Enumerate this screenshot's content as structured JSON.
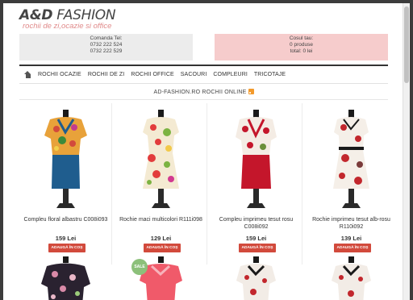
{
  "logo": {
    "brand_bold": "A&D",
    "brand_rest": " FASHION",
    "tagline": "rochii de zi,ocazie si office"
  },
  "contact": {
    "label": "Comanda Tel:",
    "phone1": "0732 222 524",
    "phone2": "0732 222 529"
  },
  "cart": {
    "label": "Cosul tau:",
    "products": "0 produse",
    "total": "total: 0 lei"
  },
  "nav": {
    "items": [
      "ROCHII OCAZIE",
      "ROCHII DE ZI",
      "ROCHII OFFICE",
      "SACOURI",
      "COMPLEURI",
      "TRICOTAJE"
    ]
  },
  "section": {
    "title": "AD-FASHION.RO ROCHII ONLINE"
  },
  "products": [
    {
      "name": "Compleu floral albastru C008i093",
      "price": "159 Lei",
      "button": "ADAUGĂ ÎN COȘ"
    },
    {
      "name": "Rochie maci multicolori R111i098",
      "price": "129 Lei",
      "button": "ADAUGĂ ÎN COȘ"
    },
    {
      "name": "Compleu imprimeu tesut rosu C008i092",
      "price": "159 Lei",
      "button": "ADAUGĂ ÎN COȘ"
    },
    {
      "name": "Rochie imprimeu tesut alb-rosu R110i092",
      "price": "139 Lei",
      "button": "ADAUGĂ ÎN COȘ"
    }
  ],
  "badge": {
    "sale": "SALE"
  },
  "colors": {
    "accent": "#d24a3c",
    "cart_bg": "#f6cccc",
    "contact_bg": "#ececec",
    "sale_badge": "#8cc07a",
    "rss": "#f39a2c"
  }
}
